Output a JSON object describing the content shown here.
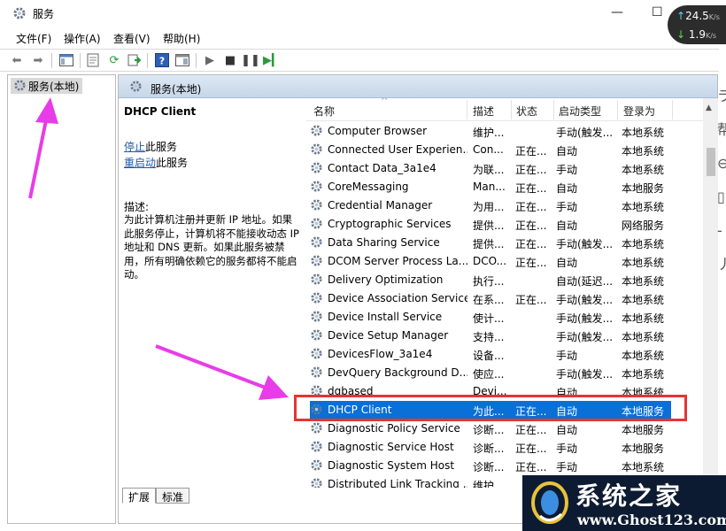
{
  "window": {
    "title": "服务",
    "minimize": "—",
    "maximize": "☐"
  },
  "net_widget": {
    "upload": "24.5",
    "upload_unit": "K/s",
    "download": "1.9",
    "download_unit": "K/s"
  },
  "menu": [
    {
      "label": "文件(F)"
    },
    {
      "label": "操作(A)"
    },
    {
      "label": "查看(V)"
    },
    {
      "label": "帮助(H)"
    }
  ],
  "tree": {
    "label": "服务(本地)"
  },
  "pane_header": {
    "label": "服务(本地)"
  },
  "description": {
    "title": "DHCP Client",
    "stop_link": "停止",
    "stop_suffix": "此服务",
    "restart_link": "重启动",
    "restart_suffix": "此服务",
    "label": "描述:",
    "text": "为此计算机注册并更新 IP 地址。如果此服务停止，计算机将不能接收动态 IP 地址和 DNS 更新。如果此服务被禁用，所有明确依赖它的服务都将不能启动。"
  },
  "columns": {
    "name": "名称",
    "desc": "描述",
    "status": "状态",
    "startup": "启动类型",
    "logon": "登录为"
  },
  "services": [
    {
      "name": "Computer Browser",
      "desc": "维护...",
      "status": "",
      "startup": "手动(触发...",
      "logon": "本地系统"
    },
    {
      "name": "Connected User Experien...",
      "desc": "Con...",
      "status": "正在...",
      "startup": "自动",
      "logon": "本地系统"
    },
    {
      "name": "Contact Data_3a1e4",
      "desc": "为联...",
      "status": "正在...",
      "startup": "手动",
      "logon": "本地系统"
    },
    {
      "name": "CoreMessaging",
      "desc": "Man...",
      "status": "正在...",
      "startup": "自动",
      "logon": "本地服务"
    },
    {
      "name": "Credential Manager",
      "desc": "为用...",
      "status": "正在...",
      "startup": "手动",
      "logon": "本地系统"
    },
    {
      "name": "Cryptographic Services",
      "desc": "提供...",
      "status": "正在...",
      "startup": "自动",
      "logon": "网络服务"
    },
    {
      "name": "Data Sharing Service",
      "desc": "提供...",
      "status": "正在...",
      "startup": "手动(触发...",
      "logon": "本地系统"
    },
    {
      "name": "DCOM Server Process La...",
      "desc": "DCO...",
      "status": "正在...",
      "startup": "自动",
      "logon": "本地系统"
    },
    {
      "name": "Delivery Optimization",
      "desc": "执行...",
      "status": "",
      "startup": "自动(延迟...",
      "logon": "本地系统"
    },
    {
      "name": "Device Association Service",
      "desc": "在系...",
      "status": "正在...",
      "startup": "手动(触发...",
      "logon": "本地系统"
    },
    {
      "name": "Device Install Service",
      "desc": "使计...",
      "status": "",
      "startup": "手动(触发...",
      "logon": "本地系统"
    },
    {
      "name": "Device Setup Manager",
      "desc": "支持...",
      "status": "",
      "startup": "手动(触发...",
      "logon": "本地系统"
    },
    {
      "name": "DevicesFlow_3a1e4",
      "desc": "设备...",
      "status": "",
      "startup": "手动",
      "logon": "本地系统"
    },
    {
      "name": "DevQuery Background D...",
      "desc": "使应...",
      "status": "",
      "startup": "手动(触发...",
      "logon": "本地系统"
    },
    {
      "name": "dgbased",
      "desc": "Devi...",
      "status": "",
      "startup": "自动",
      "logon": "本地系统"
    },
    {
      "name": "DHCP Client",
      "desc": "为此...",
      "status": "正在...",
      "startup": "自动",
      "logon": "本地服务"
    },
    {
      "name": "Diagnostic Policy Service",
      "desc": "诊断...",
      "status": "正在...",
      "startup": "自动",
      "logon": "本地服务"
    },
    {
      "name": "Diagnostic Service Host",
      "desc": "诊断...",
      "status": "正在...",
      "startup": "手动",
      "logon": "本地服务"
    },
    {
      "name": "Diagnostic System Host",
      "desc": "诊断...",
      "status": "正在...",
      "startup": "手动",
      "logon": "本地系统"
    },
    {
      "name": "Distributed Link Tracking ...",
      "desc": "维护...",
      "status": "",
      "startup": "",
      "logon": ""
    }
  ],
  "selected_service": "DHCP Client",
  "tabs": [
    {
      "label": "扩展"
    },
    {
      "label": "标准"
    }
  ],
  "watermark": {
    "title": "系统之家",
    "url": "www.Ghost123.com"
  },
  "colors": {
    "selection": "#0a6fd7",
    "highlight_box": "#e53434",
    "annotation_arrow": "#e83ce8",
    "link": "#1f5ba8"
  }
}
